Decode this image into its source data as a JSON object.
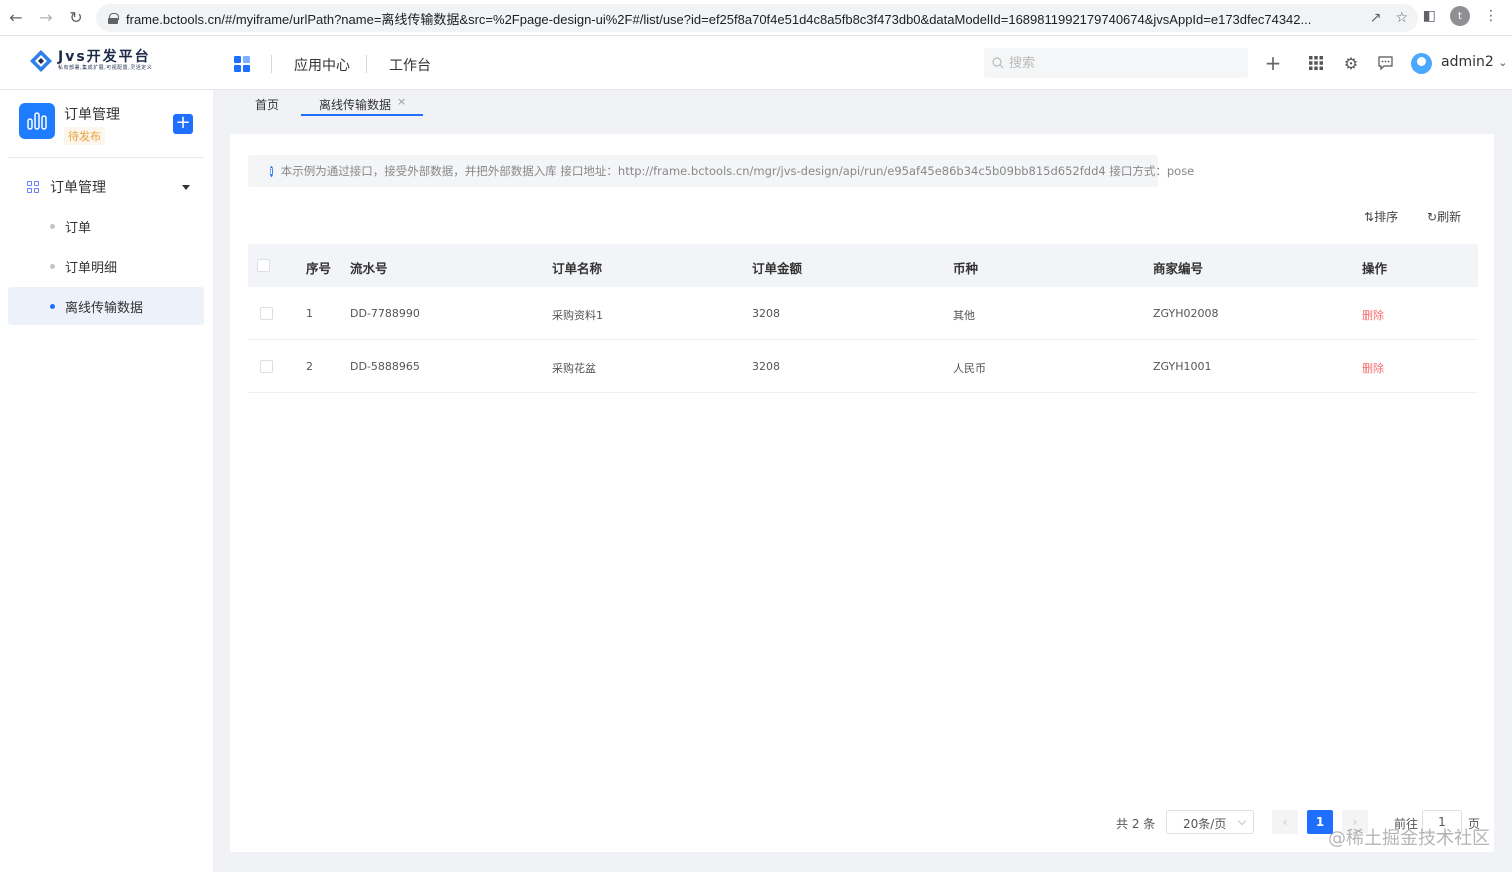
{
  "browser": {
    "url": "frame.bctools.cn/#/myiframe/urlPath?name=离线传输数据&src=%2Fpage-design-ui%2F#/list/use?id=ef25f8a70f4e51d4c8a5fb8c3f473db0&dataModelId=1689811992179740674&jvsAppId=e173dfec74342...",
    "profile_initial": "t"
  },
  "header": {
    "logo_title": "Jvs开发平台",
    "logo_subtitle": "私有部署,集成扩展,可视配置,灵活定义",
    "nav": [
      "应用中心",
      "工作台"
    ],
    "search_placeholder": "搜索",
    "user": "admin2"
  },
  "sidebar": {
    "app_name": "订单管理",
    "app_status": "待发布",
    "group_label": "订单管理",
    "items": [
      {
        "label": "订单",
        "active": false
      },
      {
        "label": "订单明细",
        "active": false
      },
      {
        "label": "离线传输数据",
        "active": true
      }
    ]
  },
  "tabs": [
    {
      "label": "首页",
      "active": false
    },
    {
      "label": "离线传输数据",
      "active": true
    }
  ],
  "notice": "本示例为通过接口，接受外部数据，并把外部数据入库 接口地址：http://frame.bctools.cn/mgr/jvs-design/api/run/e95af45e86b34c5b09bb815d652fdd4 接口方式：pose",
  "toolbar": {
    "sort": "排序",
    "refresh": "刷新"
  },
  "table": {
    "columns": [
      "序号",
      "流水号",
      "订单名称",
      "订单金额",
      "币种",
      "商家编号",
      "操作"
    ],
    "rows": [
      {
        "index": "1",
        "serial": "DD-7788990",
        "name": "采购资料1",
        "amount": "3208",
        "currency": "其他",
        "merchant": "ZGYH02008",
        "action": "删除"
      },
      {
        "index": "2",
        "serial": "DD-5888965",
        "name": "采购花盆",
        "amount": "3208",
        "currency": "人民币",
        "merchant": "ZGYH1001",
        "action": "删除"
      }
    ]
  },
  "pagination": {
    "total": "共 2 条",
    "page_size": "20条/页",
    "current": "1",
    "goto_label": "前往",
    "goto_value": "1",
    "page_label": "页"
  },
  "watermark": "@稀土掘金技术社区",
  "colors": {
    "primary": "#1e6fff",
    "danger": "#f56c6c",
    "warning": "#e6a23c"
  }
}
